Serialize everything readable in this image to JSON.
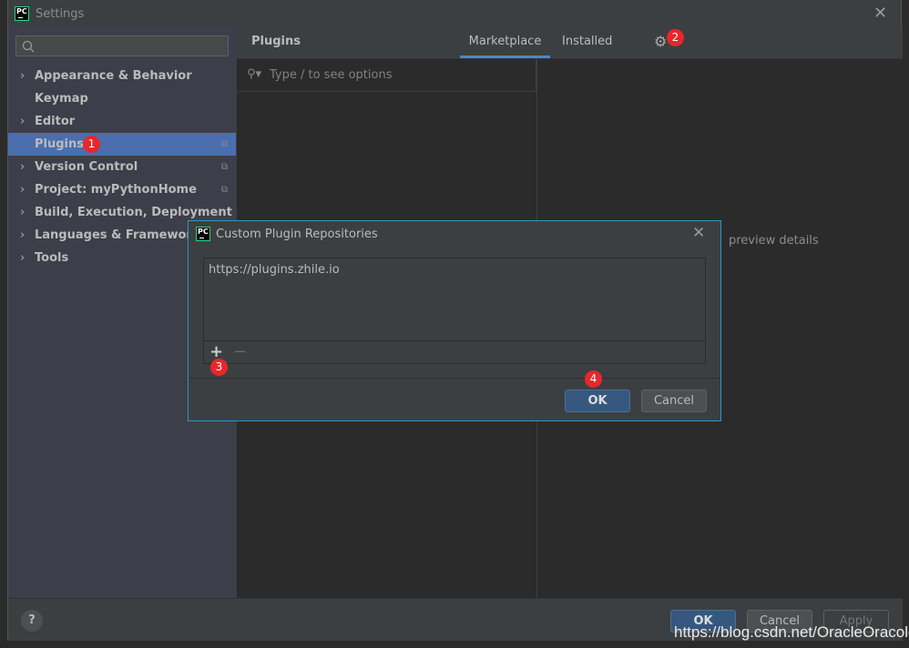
{
  "window": {
    "title": "Settings",
    "close": "✕"
  },
  "sidebar": {
    "search_placeholder": "",
    "items": [
      {
        "label": "Appearance & Behavior",
        "expandable": true
      },
      {
        "label": "Keymap",
        "expandable": false
      },
      {
        "label": "Editor",
        "expandable": true
      },
      {
        "label": "Plugins",
        "expandable": false,
        "selected": true
      },
      {
        "label": "Version Control",
        "expandable": true
      },
      {
        "label": "Project: myPythonHome",
        "expandable": true
      },
      {
        "label": "Build, Execution, Deployment",
        "expandable": true
      },
      {
        "label": "Languages & Frameworks",
        "expandable": true
      },
      {
        "label": "Tools",
        "expandable": true
      }
    ]
  },
  "plugins": {
    "title": "Plugins",
    "tabs": [
      {
        "label": "Marketplace",
        "active": true
      },
      {
        "label": "Installed",
        "active": false
      }
    ],
    "search_placeholder": "Type / to see options",
    "details_hint": "preview details"
  },
  "footer": {
    "help": "?",
    "ok": "OK",
    "cancel": "Cancel",
    "apply": "Apply"
  },
  "dialog": {
    "title": "Custom Plugin Repositories",
    "close": "✕",
    "repositories": [
      "https://plugins.zhile.io"
    ],
    "add": "+",
    "remove": "−",
    "ok": "OK",
    "cancel": "Cancel"
  },
  "annotations": [
    "1",
    "2",
    "3",
    "4"
  ],
  "watermark": "https://blog.csdn.net/OracleOracolo",
  "colors": {
    "accent": "#4b6eaf",
    "badge": "#e8262b",
    "dialog_border": "#3592c4"
  }
}
